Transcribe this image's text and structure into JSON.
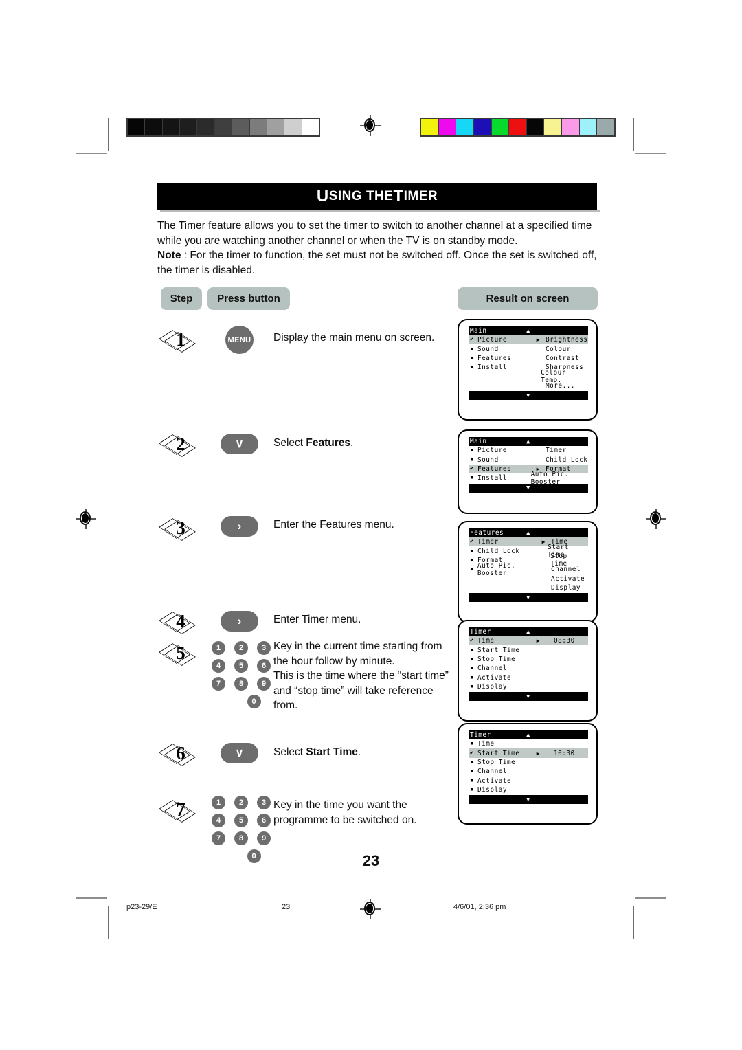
{
  "document": {
    "title_main": "U",
    "title_rest": "SING THE ",
    "title_t": "T",
    "title_timer": "IMER",
    "title_full": "USING THE TIMER",
    "page_number": "23"
  },
  "intro": {
    "paragraph1": "The Timer feature allows you to set the timer to switch to another channel at a specified time while you are watching another channel or when the TV is on standby mode.",
    "note_label": "Note",
    "note_body": " : For the timer to function, the set must not be switched off. Once the set is switched off, the timer is disabled."
  },
  "table_headers": {
    "step": "Step",
    "press_button": "Press button",
    "result_on_screen": "Result on screen"
  },
  "steps": [
    {
      "number": "1",
      "button_type": "menu",
      "button_label": "MENU",
      "description": "Display the main menu on screen."
    },
    {
      "number": "2",
      "button_type": "pill",
      "button_label": "∨",
      "description_pre": "Select ",
      "description_bold": "Features",
      "description_post": "."
    },
    {
      "number": "3",
      "button_type": "pill",
      "button_label": "›",
      "description": "Enter the Features menu."
    },
    {
      "number": "4",
      "button_type": "pill",
      "button_label": "›",
      "description": "Enter Timer menu."
    },
    {
      "number": "5",
      "button_type": "keypad",
      "description_line1": "Key in the current time starting from",
      "description_line2": "the hour follow by minute.",
      "description_line3": "This is the time where the “start time”",
      "description_line4": "and “stop time” will take reference",
      "description_line5": "from."
    },
    {
      "number": "6",
      "button_type": "pill",
      "button_label": "∨",
      "description_pre": "Select ",
      "description_bold": "Start Time",
      "description_post": "."
    },
    {
      "number": "7",
      "button_type": "keypad",
      "description_line1": "Key in the time you want the",
      "description_line2": "programme to be switched on."
    }
  ],
  "keypad": {
    "rows": [
      [
        "1",
        "2",
        "3"
      ],
      [
        "4",
        "5",
        "6"
      ],
      [
        "7",
        "8",
        "9"
      ]
    ],
    "zero": "0"
  },
  "screens": [
    {
      "id": "screen-main-picture",
      "title": "Main",
      "up_arrow": "▲",
      "down_arrow": "▼",
      "rows": [
        {
          "bullet": "check",
          "left": "Picture",
          "arrow": "▶",
          "right": "Brightness",
          "highlight": true
        },
        {
          "bullet": "square",
          "left": "Sound",
          "arrow": "",
          "right": "Colour",
          "highlight": false
        },
        {
          "bullet": "square",
          "left": "Features",
          "arrow": "",
          "right": "Contrast",
          "highlight": false
        },
        {
          "bullet": "square",
          "left": "Install",
          "arrow": "",
          "right": "Sharpness",
          "highlight": false
        },
        {
          "bullet": "none",
          "left": "",
          "arrow": "",
          "right": "Colour Temp.",
          "highlight": false
        },
        {
          "bullet": "none",
          "left": "",
          "arrow": "",
          "right": "More...",
          "highlight": false
        }
      ]
    },
    {
      "id": "screen-main-features",
      "title": "Main",
      "up_arrow": "▲",
      "down_arrow": "▼",
      "rows": [
        {
          "bullet": "square",
          "left": "Picture",
          "arrow": "",
          "right": "Timer",
          "highlight": false
        },
        {
          "bullet": "square",
          "left": "Sound",
          "arrow": "",
          "right": "Child Lock",
          "highlight": false
        },
        {
          "bullet": "check",
          "left": "Features",
          "arrow": "▶",
          "right": "Format",
          "highlight": true
        },
        {
          "bullet": "square",
          "left": "Install",
          "arrow": "",
          "right": "Auto Pic. Booster",
          "highlight": false
        }
      ]
    },
    {
      "id": "screen-features-timer",
      "title": "Features",
      "up_arrow": "▲",
      "down_arrow": "▼",
      "rows": [
        {
          "bullet": "check",
          "left": "Timer",
          "arrow": "▶",
          "right": "Time",
          "highlight": true
        },
        {
          "bullet": "square",
          "left": "Child Lock",
          "arrow": "",
          "right": "Start Time",
          "highlight": false
        },
        {
          "bullet": "square",
          "left": "Format",
          "arrow": "",
          "right": "Stop Time",
          "highlight": false
        },
        {
          "bullet": "square",
          "left": "Auto Pic. Booster",
          "arrow": "",
          "right": "Channel",
          "highlight": false
        },
        {
          "bullet": "none",
          "left": "",
          "arrow": "",
          "right": "Activate",
          "highlight": false
        },
        {
          "bullet": "none",
          "left": "",
          "arrow": "",
          "right": "Display",
          "highlight": false
        }
      ]
    },
    {
      "id": "screen-timer-time",
      "title": "Timer",
      "up_arrow": "▲",
      "down_arrow": "▼",
      "rows": [
        {
          "bullet": "check",
          "left": "Time",
          "arrow": "▶",
          "right": "08:30",
          "highlight": true
        },
        {
          "bullet": "square",
          "left": "Start Time",
          "arrow": "",
          "right": "",
          "highlight": false
        },
        {
          "bullet": "square",
          "left": "Stop Time",
          "arrow": "",
          "right": "",
          "highlight": false
        },
        {
          "bullet": "square",
          "left": "Channel",
          "arrow": "",
          "right": "",
          "highlight": false
        },
        {
          "bullet": "square",
          "left": "Activate",
          "arrow": "",
          "right": "",
          "highlight": false
        },
        {
          "bullet": "square",
          "left": "Display",
          "arrow": "",
          "right": "",
          "highlight": false
        }
      ]
    },
    {
      "id": "screen-timer-starttime",
      "title": "Timer",
      "up_arrow": "▲",
      "down_arrow": "▼",
      "rows": [
        {
          "bullet": "square",
          "left": "Time",
          "arrow": "",
          "right": "",
          "highlight": false
        },
        {
          "bullet": "check",
          "left": "Start Time",
          "arrow": "▶",
          "right": "10:30",
          "highlight": true
        },
        {
          "bullet": "square",
          "left": "Stop Time",
          "arrow": "",
          "right": "",
          "highlight": false
        },
        {
          "bullet": "square",
          "left": "Channel",
          "arrow": "",
          "right": "",
          "highlight": false
        },
        {
          "bullet": "square",
          "left": "Activate",
          "arrow": "",
          "right": "",
          "highlight": false
        },
        {
          "bullet": "square",
          "left": "Display",
          "arrow": "",
          "right": "",
          "highlight": false
        }
      ]
    }
  ],
  "footer": {
    "file_ref": "p23-29/E",
    "page_num": "23",
    "timestamp": "4/6/01, 2:36 pm"
  },
  "calibration": {
    "grayscale": [
      "#060606",
      "#0d0d0d",
      "#141414",
      "#1e1e1e",
      "#2b2b2b",
      "#3f3f3f",
      "#5c5c5c",
      "#7c7c7c",
      "#a0a0a0",
      "#cfcfcf",
      "#ffffff"
    ],
    "colors": [
      "#f2f20c",
      "#ee09ee",
      "#16d7f5",
      "#1b0fb5",
      "#07da2c",
      "#ee1010",
      "#070707",
      "#f7f392",
      "#fa9ae8",
      "#9df2f9",
      "#9aa9a9"
    ]
  },
  "colors": {
    "pill_bg": "#b6c2bf",
    "button_gray": "#6d6d6d",
    "osd_highlight": "#c0c9c6",
    "title_bar": "#000000"
  }
}
